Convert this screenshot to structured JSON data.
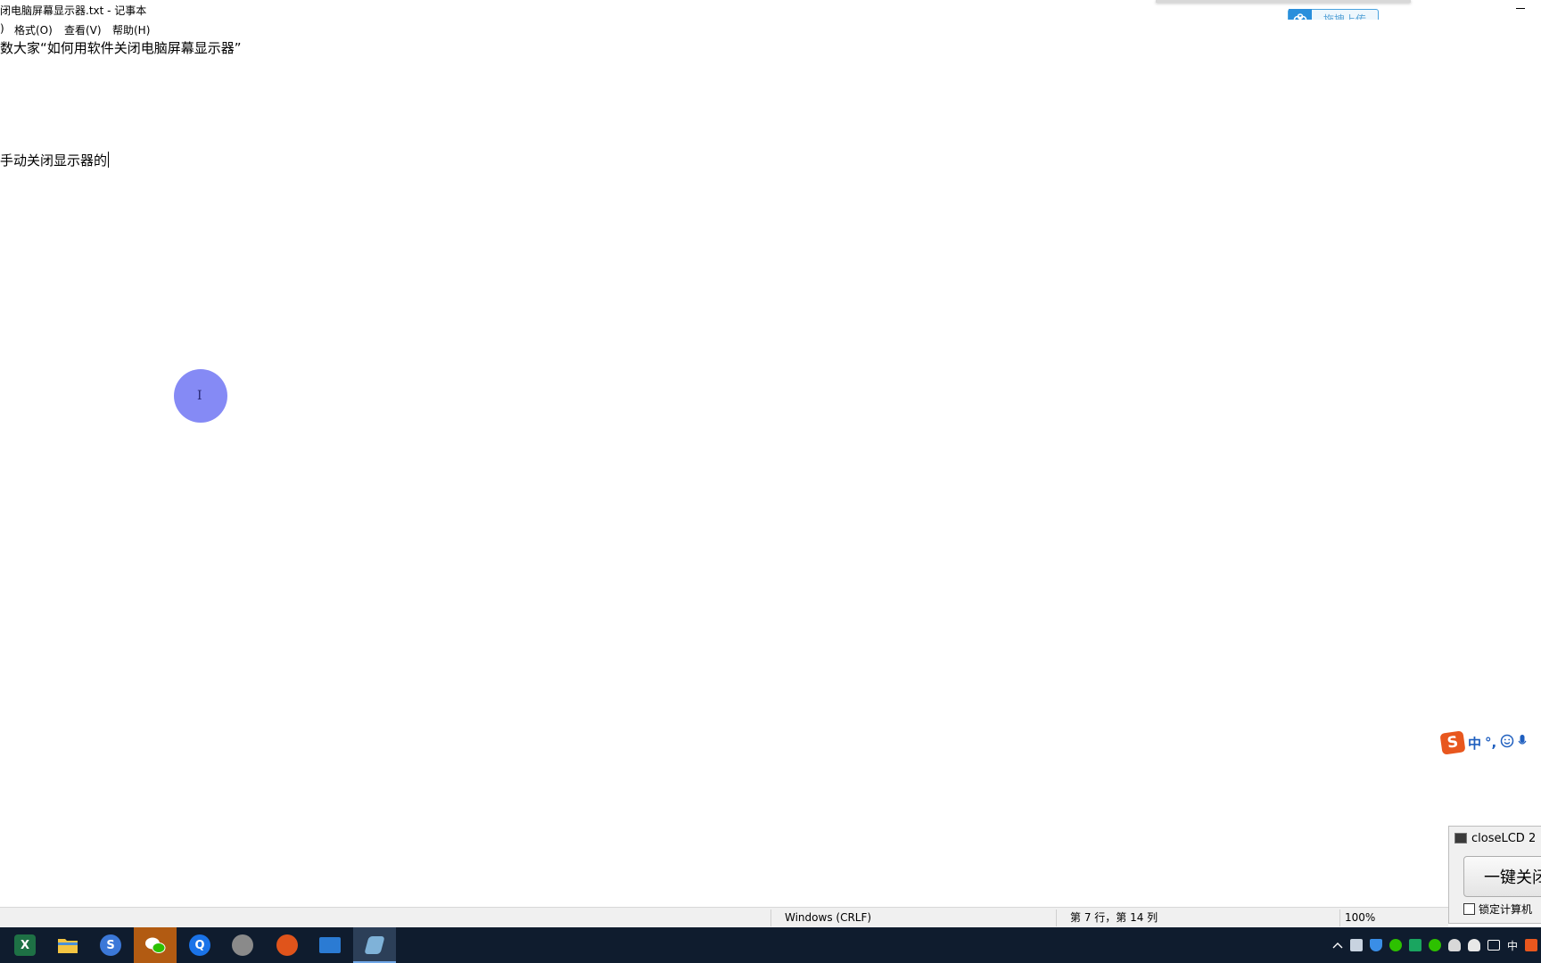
{
  "window": {
    "title": "闭电脑屏幕显示器.txt - 记事本",
    "baidu_upload_label": "拖拽上传"
  },
  "menu": {
    "partial_item": ")",
    "format": "格式(O)",
    "view": "查看(V)",
    "help": "帮助(H)"
  },
  "document": {
    "lines": [
      "数大家“如何用软件关闭电脑屏幕显示器”",
      "手动关闭显示器的"
    ]
  },
  "cursor": {
    "glyph": "I"
  },
  "ime": {
    "logo": "S",
    "mode": "中",
    "punct": "°,",
    "emoji_icon": "smile-icon",
    "mic_icon": "microphone-icon"
  },
  "closelcd": {
    "title": "closeLCD 2",
    "button_label": "一键关闭",
    "lock_label": "锁定计算机",
    "lock_checked": false
  },
  "statusbar": {
    "encoding": "Windows (CRLF)",
    "position": "第 7 行，第 14 列",
    "zoom": "100%"
  },
  "taskbar": {
    "apps": [
      {
        "name": "excel-icon",
        "glyph": "X",
        "color": "#1e7145"
      },
      {
        "name": "file-explorer-icon",
        "glyph": "",
        "color": "#f4c542"
      },
      {
        "name": "sogou-browser-icon",
        "glyph": "S",
        "color": "#3b78d8"
      },
      {
        "name": "wechat-icon",
        "glyph": "",
        "color": "#2dc100"
      },
      {
        "name": "search-icon",
        "glyph": "Q",
        "color": "#1a73e8"
      },
      {
        "name": "avatar-app-icon",
        "glyph": "",
        "color": "#8a8a8a"
      },
      {
        "name": "game-app-icon",
        "glyph": "",
        "color": "#e0541b"
      },
      {
        "name": "remote-desktop-icon",
        "glyph": "",
        "color": "#2b7bd3"
      },
      {
        "name": "notepad-icon",
        "glyph": "",
        "color": "#7fb2d8"
      }
    ],
    "tray_ime": "中"
  }
}
